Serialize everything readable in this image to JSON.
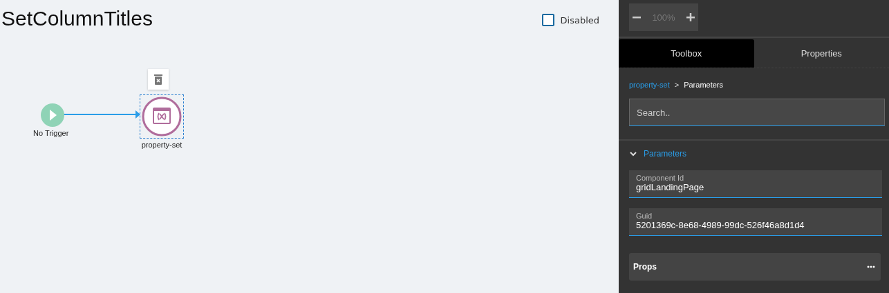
{
  "title": "SetColumnTitles",
  "disabled_toggle": {
    "label": "Disabled",
    "checked": false
  },
  "canvas": {
    "nodes": [
      {
        "kind": "trigger",
        "label": "No Trigger",
        "selected": false
      },
      {
        "kind": "action",
        "label": "property-set",
        "selected": true
      }
    ]
  },
  "zoom": {
    "value": "100%"
  },
  "tabs": [
    {
      "label": "Toolbox",
      "selected": true
    },
    {
      "label": "Properties",
      "selected": false
    }
  ],
  "breadcrumb": {
    "link": "property-set",
    "separator": ">",
    "current": "Parameters"
  },
  "search": {
    "placeholder": "Search.."
  },
  "section": {
    "title": "Parameters",
    "expanded": true,
    "fields": [
      {
        "label": "Component Id",
        "value": "gridLandingPage"
      },
      {
        "label": "Guid",
        "value": "5201369c-8e68-4989-99dc-526f46a8d1d4"
      }
    ],
    "props": {
      "label": "Props"
    }
  }
}
